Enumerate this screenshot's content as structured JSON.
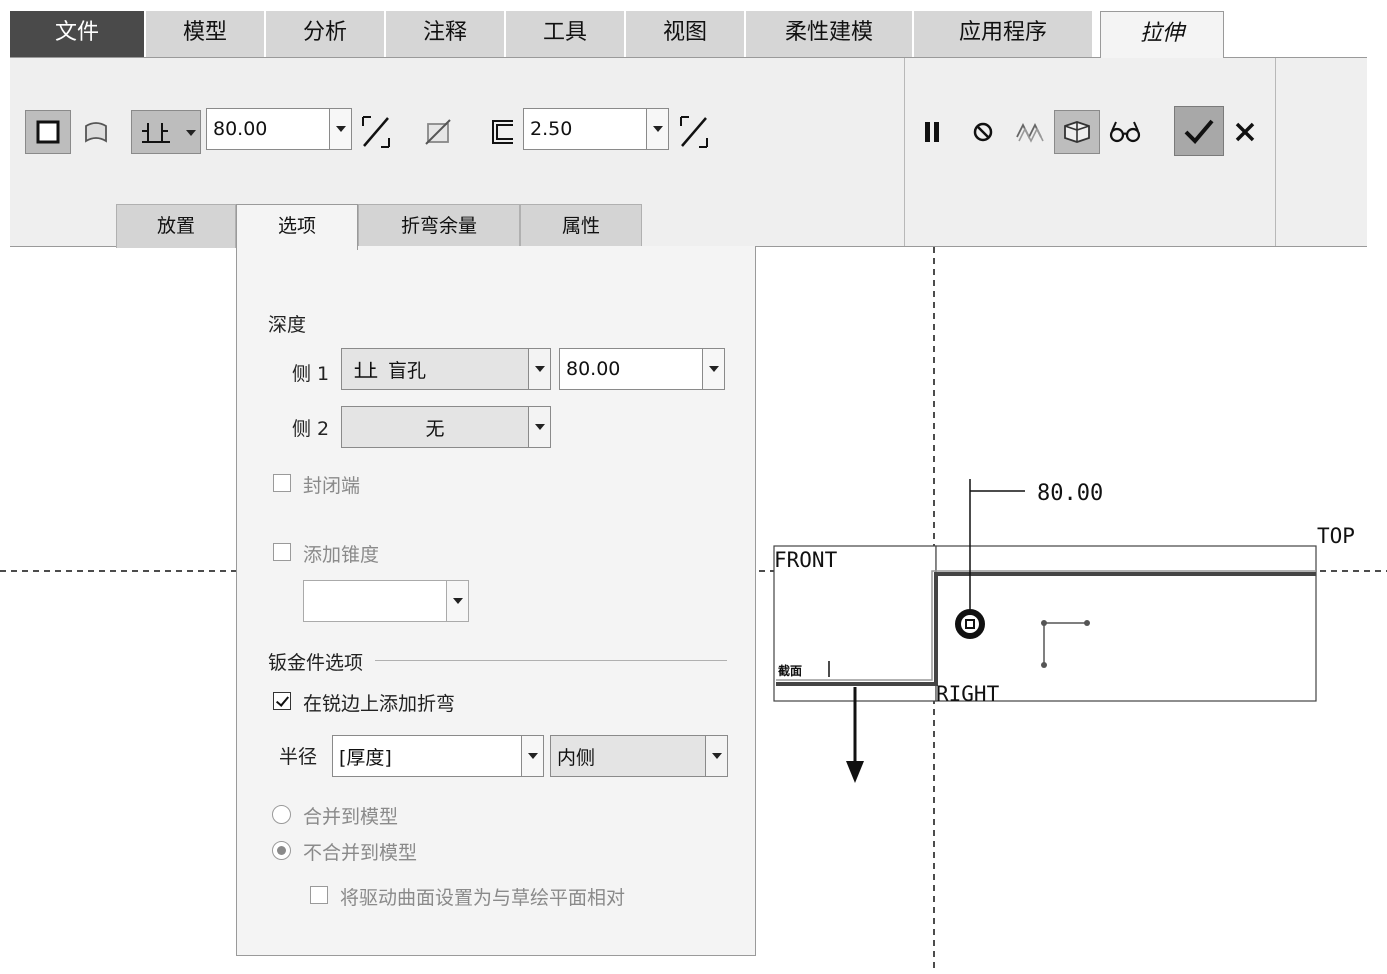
{
  "ribbon": {
    "tabs": [
      {
        "label": "文件"
      },
      {
        "label": "模型"
      },
      {
        "label": "分析"
      },
      {
        "label": "注释"
      },
      {
        "label": "工具"
      },
      {
        "label": "视图"
      },
      {
        "label": "柔性建模"
      },
      {
        "label": "应用程序"
      },
      {
        "label": "拉伸"
      }
    ]
  },
  "toolbar": {
    "icons": {
      "solid": "solid-extrude-icon",
      "surface": "surface-extrude-icon",
      "depth_type": "blind-depth-icon",
      "flip_direction": "flip-direction-icon",
      "remove_material": "remove-material-icon",
      "thicken": "thicken-sketch-icon",
      "pause": "pause-icon",
      "no_preview": "no-preview-icon",
      "preview": "preview-icon",
      "verify": "verify-icon",
      "glasses": "glasses-icon",
      "ok": "checkmark-icon",
      "cancel": "close-icon"
    },
    "depth_value": "80.00",
    "thickness_value": "2.50"
  },
  "subtabs": [
    {
      "label": "放置"
    },
    {
      "label": "选项"
    },
    {
      "label": "折弯余量"
    },
    {
      "label": "属性"
    }
  ],
  "options": {
    "depth_heading": "深度",
    "side1_label": "侧 1",
    "side1_type": "盲孔",
    "side1_value": "80.00",
    "side2_label": "侧 2",
    "side2_type": "无",
    "capped_ends_label": "封闭端",
    "add_taper_label": "添加锥度",
    "taper_value": "",
    "sheetmetal_heading": "钣金件选项",
    "add_bends_label": "在锐边上添加折弯",
    "radius_label": "半径",
    "radius_value": "[厚度]",
    "radius_side": "内侧",
    "merge_label": "合并到模型",
    "no_merge_label": "不合并到模型",
    "driving_surface_label": "将驱动曲面设置为与草绘平面相对"
  },
  "canvas": {
    "dimension_label": "80.00",
    "plane_front": "FRONT",
    "plane_top": "TOP",
    "plane_right": "RIGHT",
    "section_label": "截面"
  },
  "colors": {
    "tab_bg": "#d6d6d6",
    "file_tab_bg": "#4a4a4a",
    "toolbar_bg": "#efefef",
    "panel_bg": "#f4f4f4",
    "ok_button_bg": "#a8a8a8"
  }
}
